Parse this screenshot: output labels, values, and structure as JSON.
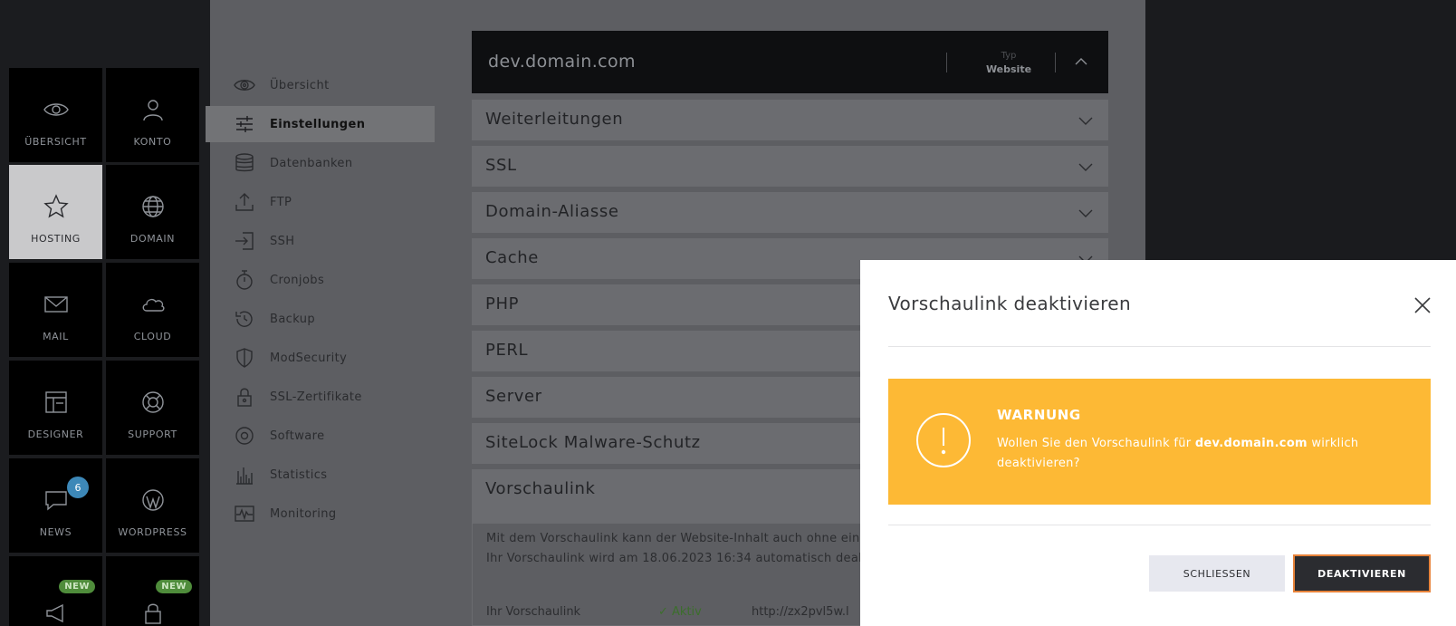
{
  "tiles": [
    {
      "label": "ÜBERSICHT",
      "icon": "eye-icon"
    },
    {
      "label": "KONTO",
      "icon": "user-icon"
    },
    {
      "label": "HOSTING",
      "icon": "star-icon"
    },
    {
      "label": "DOMAIN",
      "icon": "globe-icon"
    },
    {
      "label": "MAIL",
      "icon": "mail-icon"
    },
    {
      "label": "CLOUD",
      "icon": "cloud-icon"
    },
    {
      "label": "DESIGNER",
      "icon": "layout-icon"
    },
    {
      "label": "SUPPORT",
      "icon": "lifebuoy-icon"
    },
    {
      "label": "NEWS",
      "icon": "chat-icon",
      "badge": "6"
    },
    {
      "label": "WORDPRESS",
      "icon": "wordpress-icon"
    },
    {
      "label": "",
      "icon": "megaphone-icon",
      "badge": "NEW"
    },
    {
      "label": "",
      "icon": "lock-icon",
      "badge": "NEW"
    }
  ],
  "menu": [
    {
      "label": "Übersicht",
      "icon": "eye-icon"
    },
    {
      "label": "Einstellungen",
      "icon": "sliders-icon",
      "active": true
    },
    {
      "label": "Datenbanken",
      "icon": "database-icon"
    },
    {
      "label": "FTP",
      "icon": "upload-icon"
    },
    {
      "label": "SSH",
      "icon": "login-icon"
    },
    {
      "label": "Cronjobs",
      "icon": "stopwatch-icon"
    },
    {
      "label": "Backup",
      "icon": "history-icon"
    },
    {
      "label": "ModSecurity",
      "icon": "shield-icon"
    },
    {
      "label": "SSL-Zertifikate",
      "icon": "lock-icon"
    },
    {
      "label": "Software",
      "icon": "disc-icon"
    },
    {
      "label": "Statistics",
      "icon": "bar-chart-icon"
    },
    {
      "label": "Monitoring",
      "icon": "pulse-icon"
    }
  ],
  "domain": {
    "name": "dev.domain.com",
    "type_label": "Typ",
    "type_value": "Website"
  },
  "accordion": [
    "Weiterleitungen",
    "SSL",
    "Domain-Aliasse",
    "Cache",
    "PHP",
    "PERL",
    "Server",
    "SiteLock Malware-Schutz",
    "Vorschaulink"
  ],
  "preview": {
    "text_line1": "Mit dem Vorschaulink kann der Website-Inhalt auch ohne ein",
    "text_line2": "Ihr Vorschaulink wird am 18.06.2023 16:34 automatisch deak",
    "link_label": "Ihr Vorschaulink",
    "status": "✓ Aktiv",
    "url": "http://zx2pvl5w.l"
  },
  "modal": {
    "title": "Vorschaulink deaktivieren",
    "warning_title": "WARNUNG",
    "warning_pre": "Wollen Sie den Vorschaulink für ",
    "warning_domain": "dev.domain.com",
    "warning_post": " wirklich deaktivieren?",
    "close_label": "SCHLIESSEN",
    "deactivate_label": "DEAKTIVIEREN"
  },
  "colors": {
    "warning": "#fdb935",
    "primary_button": "#2b2c30",
    "focus_outline": "#e8833a",
    "badge_blue": "#3d88b8",
    "badge_green": "#4f8c3b"
  }
}
